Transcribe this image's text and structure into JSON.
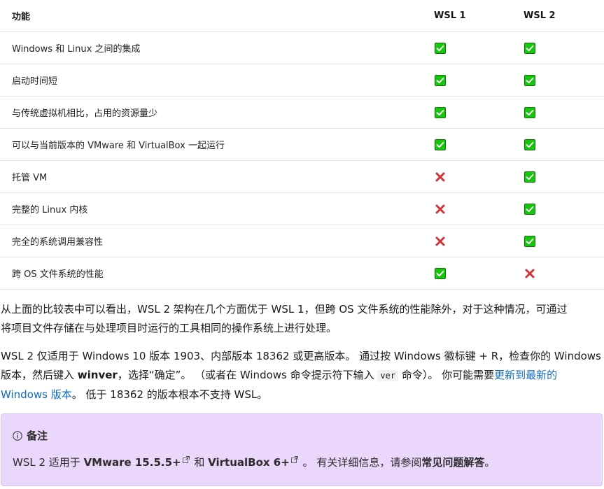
{
  "table": {
    "headers": [
      "功能",
      "WSL 1",
      "WSL 2"
    ],
    "rows": [
      {
        "feature": "Windows 和 Linux 之间的集成",
        "wsl1": "check",
        "wsl2": "check"
      },
      {
        "feature": "启动时间短",
        "wsl1": "check",
        "wsl2": "check"
      },
      {
        "feature": "与传统虚拟机相比，占用的资源量少",
        "wsl1": "check",
        "wsl2": "check"
      },
      {
        "feature": "可以与当前版本的 VMware 和 VirtualBox 一起运行",
        "wsl1": "check",
        "wsl2": "check"
      },
      {
        "feature": "托管 VM",
        "wsl1": "cross",
        "wsl2": "check"
      },
      {
        "feature": "完整的 Linux 内核",
        "wsl1": "cross",
        "wsl2": "check"
      },
      {
        "feature": "完全的系统调用兼容性",
        "wsl1": "cross",
        "wsl2": "check"
      },
      {
        "feature": "跨 OS 文件系统的性能",
        "wsl1": "check",
        "wsl2": "cross"
      }
    ]
  },
  "paragraph1": {
    "line1": "从上面的比较表中可以看出，WSL 2 架构在几个方面优于 WSL 1，但跨 OS 文件系统的性能除外，对于这种情况，可通过",
    "line2": "将项目文件存储在与处理项目时运行的工具相同的操作系统上进行处理。"
  },
  "paragraph2": {
    "line1": "WSL 2 仅适用于 Windows 10 版本 1903、内部版本 18362 或更高版本。 通过按 Windows 徽标键 + R，检查你的 Windows",
    "line2_a": "版本，然后键入 ",
    "line2_b": "winver",
    "line2_c": "，选择“确定”。 （或者在 Windows 命令提示符下输入 ",
    "line2_code": "ver",
    "line2_d": " 命令）。 你可能需要",
    "link_a": "更新到最新的",
    "link_b": "Windows 版本",
    "line3_rest": "。 低于 18362 的版本根本不支持 WSL。"
  },
  "note": {
    "title": "备注",
    "text_a": "WSL 2 适用于 ",
    "vmware": "VMware 15.5.5+",
    "text_b": " 和 ",
    "virtualbox": "VirtualBox 6+",
    "text_c": " 。 有关详细信息，请参阅",
    "faq": "常见问题解答",
    "text_d": "。"
  },
  "colors": {
    "check_fill": "#16c60c",
    "check_border": "#0b7a05",
    "cross": "#d13438",
    "note_bg": "#ebd7fb",
    "link": "#0f6cbd"
  }
}
